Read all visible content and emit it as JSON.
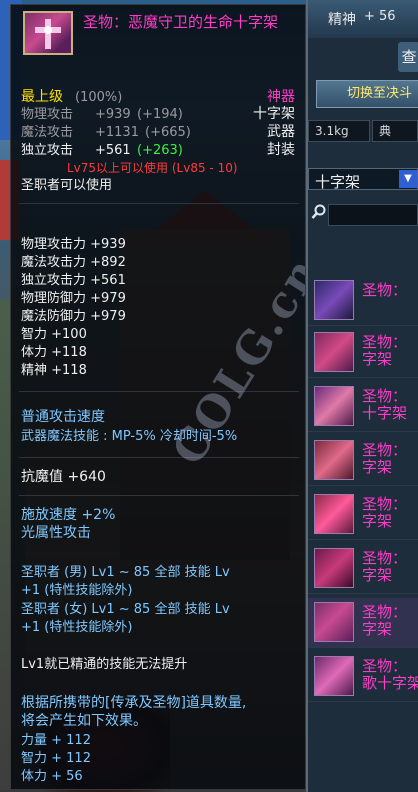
{
  "tooltip": {
    "item_name": "圣物：恶魔守卫的生命十字架",
    "upgrade_level": "最上级",
    "upgrade_pct": "(100%)",
    "rarity": "神器",
    "type": "十字架",
    "category": "武器",
    "seal": "封装",
    "base_stats": [
      {
        "label": "物理攻击",
        "value": "+939",
        "bonus": "(+194)"
      },
      {
        "label": "魔法攻击",
        "value": "+1131",
        "bonus": "(+665)"
      },
      {
        "label": "独立攻击",
        "value": "+561",
        "bonus": "(+263)"
      }
    ],
    "level_req": "Lv75以上可以使用 (Lv85 - 10)",
    "class_req": "圣职者可以使用",
    "attributes": [
      "物理攻击力 +939",
      "魔法攻击力 +892",
      "独立攻击力 +561",
      "物理防御力 +979",
      "魔法防御力 +979",
      "智力 +100",
      "体力 +118",
      "精神 +118"
    ],
    "speed_line1": "普通攻击速度",
    "speed_line2": "武器魔法技能 : MP-5% 冷却时间-5%",
    "anti_magic": "抗魔值 +640",
    "cast_speed": "施放速度 +2%",
    "light_attack": "光属性攻击",
    "skill_male_1": "圣职者 (男) Lv1 ~ 85 全部 技能 Lv",
    "skill_male_2": "+1 (特性技能除外)",
    "skill_female_1": "圣职者 (女) Lv1 ~ 85 全部 技能 Lv",
    "skill_female_2": "+1 (特性技能除外)",
    "mastered_note": "Lv1就已精通的技能无法提升",
    "set_desc_1": "根据所携带的[传承及圣物]道具数量,",
    "set_desc_2": "将会产生如下效果。",
    "set_bonuses": [
      "力量 + 112",
      "智力 + 112",
      "体力 + 56"
    ]
  },
  "watermark": "COLG.cn",
  "panel": {
    "stat_label": "精神",
    "stat_value": "+ 56",
    "view_btn": "查",
    "switch_btn": "切换至决斗",
    "tab_weight": "3.1kg",
    "tab_dict": "典",
    "select_value": "十字架",
    "list_items": [
      "圣物：",
      "圣物：\n字架",
      "圣物：\n十字架",
      "圣物：\n字架",
      "圣物：\n字架",
      "圣物：\n字架",
      "圣物：\n字架",
      "圣物：\n歌十字架"
    ]
  }
}
